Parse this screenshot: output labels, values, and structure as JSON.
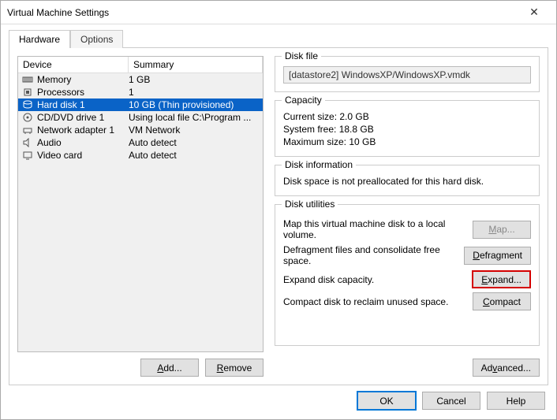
{
  "window": {
    "title": "Virtual Machine Settings"
  },
  "tabs": {
    "hardware": "Hardware",
    "options": "Options"
  },
  "list": {
    "header_device": "Device",
    "header_summary": "Summary",
    "items": [
      {
        "name": "Memory",
        "summary": "1 GB"
      },
      {
        "name": "Processors",
        "summary": "1"
      },
      {
        "name": "Hard disk 1",
        "summary": "10 GB (Thin provisioned)"
      },
      {
        "name": "CD/DVD drive 1",
        "summary": "Using local file C:\\Program ..."
      },
      {
        "name": "Network adapter 1",
        "summary": "VM Network"
      },
      {
        "name": "Audio",
        "summary": "Auto detect"
      },
      {
        "name": "Video card",
        "summary": "Auto detect"
      }
    ]
  },
  "left_buttons": {
    "add": "Add...",
    "remove": "Remove"
  },
  "disk_file": {
    "legend": "Disk file",
    "path": "[datastore2] WindowsXP/WindowsXP.vmdk"
  },
  "capacity": {
    "legend": "Capacity",
    "current_label": "Current size:",
    "current_value": "2.0 GB",
    "sysfree_label": "System free:",
    "sysfree_value": "18.8 GB",
    "max_label": "Maximum size:",
    "max_value": "10 GB"
  },
  "disk_info": {
    "legend": "Disk information",
    "text": "Disk space is not preallocated for this hard disk."
  },
  "utilities": {
    "legend": "Disk utilities",
    "map_desc": "Map this virtual machine disk to a local volume.",
    "map_btn": "Map...",
    "defrag_desc": "Defragment files and consolidate free space.",
    "defrag_btn": "Defragment",
    "expand_desc": "Expand disk capacity.",
    "expand_btn": "Expand...",
    "compact_desc": "Compact disk to reclaim unused space.",
    "compact_btn": "Compact"
  },
  "advanced_btn": "Advanced...",
  "dialog": {
    "ok": "OK",
    "cancel": "Cancel",
    "help": "Help"
  }
}
